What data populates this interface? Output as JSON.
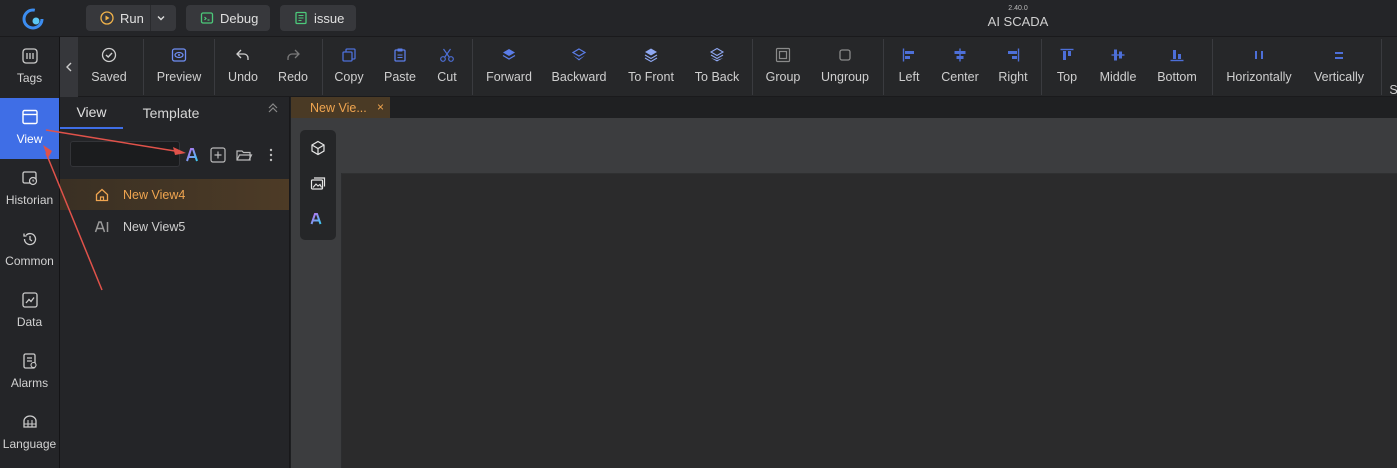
{
  "titlebar": {
    "run_label": "Run",
    "debug_label": "Debug",
    "issue_label": "issue",
    "app_title": "AI SCADA",
    "version": "2.40.0"
  },
  "sidebar": {
    "items": [
      {
        "label": "Tags",
        "icon": "tags-icon"
      },
      {
        "label": "View",
        "icon": "view-icon",
        "active": true
      },
      {
        "label": "Historian",
        "icon": "historian-icon"
      },
      {
        "label": "Common",
        "icon": "common-icon"
      },
      {
        "label": "Data",
        "icon": "data-icon"
      },
      {
        "label": "Alarms",
        "icon": "alarms-icon"
      },
      {
        "label": "Language",
        "icon": "language-icon"
      }
    ]
  },
  "toolbar": {
    "saved": "Saved",
    "preview": "Preview",
    "undo": "Undo",
    "redo": "Redo",
    "copy": "Copy",
    "paste": "Paste",
    "cut": "Cut",
    "forward": "Forward",
    "backward": "Backward",
    "to_front": "To Front",
    "to_back": "To Back",
    "group": "Group",
    "ungroup": "Ungroup",
    "left": "Left",
    "center": "Center",
    "right": "Right",
    "top": "Top",
    "middle": "Middle",
    "bottom": "Bottom",
    "horizontally": "Horizontally",
    "vertically": "Vertically",
    "more_partial": "S"
  },
  "panel": {
    "tabs": [
      "View",
      "Template"
    ],
    "ai_badge": "AI",
    "views": [
      {
        "label": "New View4",
        "icon": "home-icon",
        "selected": true
      },
      {
        "label": "New View5",
        "icon": "ai-view-icon",
        "selected": false
      }
    ]
  },
  "editor": {
    "doc_tab": "New Vie...",
    "doc_tab_close": "×",
    "tool_ai": "AI"
  },
  "colors": {
    "accent": "#3f6ee6",
    "selected_text": "#f0a550",
    "annotation_arrow": "#e0524a"
  }
}
